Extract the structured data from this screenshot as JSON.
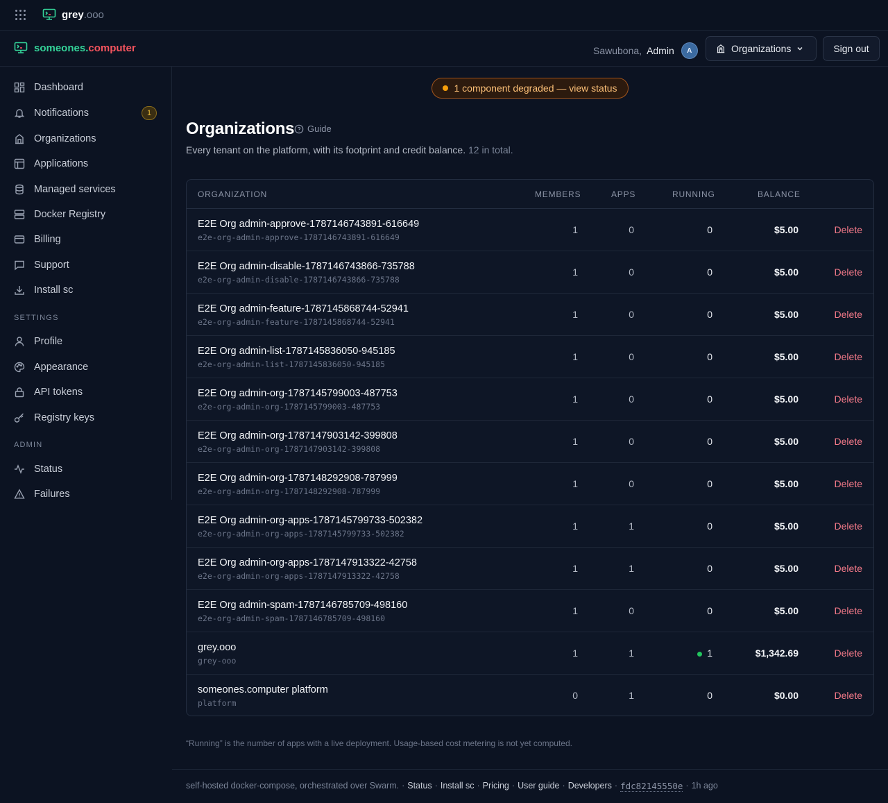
{
  "topbar": {
    "brand_name": "grey",
    "brand_suffix": ".ooo"
  },
  "header": {
    "logo_name": "someones.",
    "logo_suffix": "computer",
    "greeting": "Sawubona,",
    "user_name": "Admin",
    "avatar_initial": "A",
    "org_button_label": "Organizations",
    "signout_label": "Sign out"
  },
  "sidebar": {
    "items": [
      {
        "label": "Dashboard",
        "icon": "dashboard-icon"
      },
      {
        "label": "Notifications",
        "icon": "bell-icon",
        "badge": "1"
      },
      {
        "label": "Organizations",
        "icon": "building-icon"
      },
      {
        "label": "Applications",
        "icon": "layout-icon"
      },
      {
        "label": "Managed services",
        "icon": "database-icon"
      },
      {
        "label": "Docker Registry",
        "icon": "server-icon"
      },
      {
        "label": "Billing",
        "icon": "credit-card-icon"
      },
      {
        "label": "Support",
        "icon": "message-icon"
      },
      {
        "label": "Install sc",
        "icon": "download-icon"
      }
    ],
    "settings_label": "SETTINGS",
    "settings_items": [
      {
        "label": "Profile",
        "icon": "user-icon"
      },
      {
        "label": "Appearance",
        "icon": "palette-icon"
      },
      {
        "label": "API tokens",
        "icon": "lock-icon"
      },
      {
        "label": "Registry keys",
        "icon": "key-icon"
      }
    ],
    "admin_label": "ADMIN",
    "admin_items": [
      {
        "label": "Status",
        "icon": "activity-icon"
      },
      {
        "label": "Failures",
        "icon": "warning-icon"
      }
    ]
  },
  "status_pill": "1 component degraded — view status",
  "page": {
    "title": "Organizations",
    "guide_label": "Guide",
    "subtitle": "Every tenant on the platform, with its footprint and credit balance.",
    "count_text": "12 in total."
  },
  "table": {
    "columns": [
      "ORGANIZATION",
      "MEMBERS",
      "APPS",
      "RUNNING",
      "BALANCE"
    ],
    "delete_label": "Delete",
    "rows": [
      {
        "name": "E2E Org admin-approve-1787146743891-616649",
        "slug": "e2e-org-admin-approve-1787146743891-616649",
        "members": "1",
        "apps": "0",
        "running": "0",
        "balance": "$5.00"
      },
      {
        "name": "E2E Org admin-disable-1787146743866-735788",
        "slug": "e2e-org-admin-disable-1787146743866-735788",
        "members": "1",
        "apps": "0",
        "running": "0",
        "balance": "$5.00"
      },
      {
        "name": "E2E Org admin-feature-1787145868744-52941",
        "slug": "e2e-org-admin-feature-1787145868744-52941",
        "members": "1",
        "apps": "0",
        "running": "0",
        "balance": "$5.00"
      },
      {
        "name": "E2E Org admin-list-1787145836050-945185",
        "slug": "e2e-org-admin-list-1787145836050-945185",
        "members": "1",
        "apps": "0",
        "running": "0",
        "balance": "$5.00"
      },
      {
        "name": "E2E Org admin-org-1787145799003-487753",
        "slug": "e2e-org-admin-org-1787145799003-487753",
        "members": "1",
        "apps": "0",
        "running": "0",
        "balance": "$5.00"
      },
      {
        "name": "E2E Org admin-org-1787147903142-399808",
        "slug": "e2e-org-admin-org-1787147903142-399808",
        "members": "1",
        "apps": "0",
        "running": "0",
        "balance": "$5.00"
      },
      {
        "name": "E2E Org admin-org-1787148292908-787999",
        "slug": "e2e-org-admin-org-1787148292908-787999",
        "members": "1",
        "apps": "0",
        "running": "0",
        "balance": "$5.00"
      },
      {
        "name": "E2E Org admin-org-apps-1787145799733-502382",
        "slug": "e2e-org-admin-org-apps-1787145799733-502382",
        "members": "1",
        "apps": "1",
        "running": "0",
        "balance": "$5.00"
      },
      {
        "name": "E2E Org admin-org-apps-1787147913322-42758",
        "slug": "e2e-org-admin-org-apps-1787147913322-42758",
        "members": "1",
        "apps": "1",
        "running": "0",
        "balance": "$5.00"
      },
      {
        "name": "E2E Org admin-spam-1787146785709-498160",
        "slug": "e2e-org-admin-spam-1787146785709-498160",
        "members": "1",
        "apps": "0",
        "running": "0",
        "balance": "$5.00"
      },
      {
        "name": "grey.ooo",
        "slug": "grey-ooo",
        "members": "1",
        "apps": "1",
        "running": "1",
        "running_live": true,
        "balance": "$1,342.69"
      },
      {
        "name": "someones.computer platform",
        "slug": "platform",
        "members": "0",
        "apps": "1",
        "running": "0",
        "balance": "$0.00"
      }
    ]
  },
  "footnote": "“Running” is the number of apps with a live deployment. Usage-based cost metering is not yet computed.",
  "footer": {
    "text": "self-hosted docker-compose, orchestrated over Swarm.",
    "links": [
      "Status",
      "Install sc",
      "Pricing",
      "User guide",
      "Developers"
    ],
    "commit": "fdc82145550e",
    "age": "1h ago"
  },
  "colors": {
    "background": "#0c1322",
    "accent_green": "#34d399",
    "accent_red": "#f4545e",
    "warning": "#f59e0b",
    "delete": "#f47a89"
  }
}
